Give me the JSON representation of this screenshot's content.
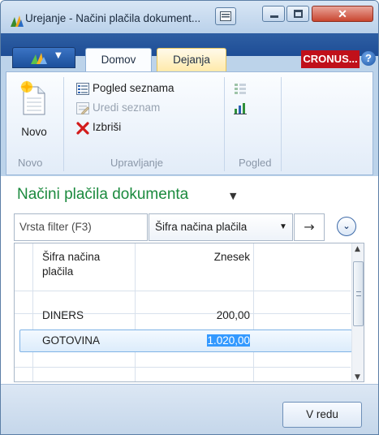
{
  "window": {
    "title": "Urejanje - Načini plačila dokument..."
  },
  "ribbon": {
    "tabs": [
      {
        "label": "Domov",
        "active": true
      },
      {
        "label": "Dejanja",
        "active": false
      }
    ],
    "company": "CRONUS...",
    "help": "?",
    "groups": {
      "novo": {
        "label": "Novo",
        "new_button": "Novo"
      },
      "upravljanje": {
        "label": "Upravljanje",
        "pogled_seznama": "Pogled seznama",
        "uredi_seznam": "Uredi seznam",
        "izbrisi": "Izbriši"
      },
      "pogled": {
        "label": "Pogled"
      }
    }
  },
  "page": {
    "title": "Načini plačila dokumenta"
  },
  "filter": {
    "placeholder": "Vrsta filter (F3)",
    "field": "Šifra načina plačila"
  },
  "grid": {
    "columns": [
      "Šifra načina plačila",
      "Znesek"
    ],
    "rows": [
      {
        "code": "DINERS",
        "amount": "200,00",
        "selected": false
      },
      {
        "code": "GOTOVINA",
        "amount": "1.020,00",
        "selected": true
      }
    ]
  },
  "footer": {
    "ok_label": "V redu"
  },
  "colors": {
    "title_green": "#1b8a3e",
    "ribbon_blue": "#1e4d96",
    "company_red": "#c0101a",
    "selection": "#3399ff"
  }
}
